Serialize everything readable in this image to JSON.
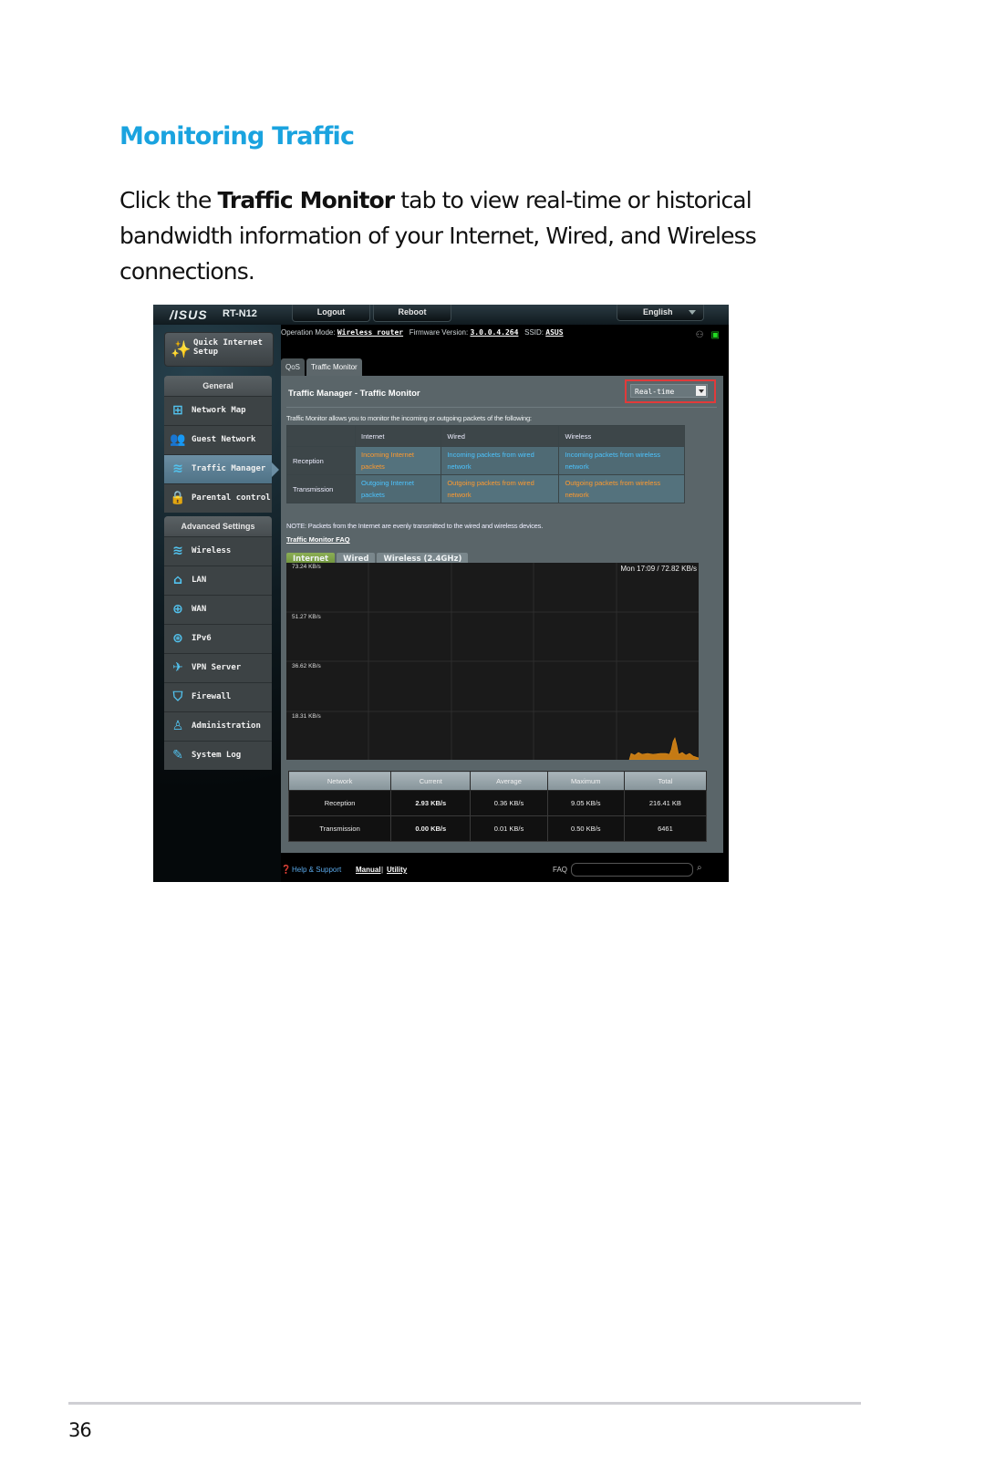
{
  "doc": {
    "title": "Monitoring Traffic",
    "para_prefix": "Click the ",
    "para_bold": "Traffic Monitor",
    "para_suffix": " tab to view real-time or historical bandwidth information of your Internet, Wired, and Wireless connections.",
    "page_number": "36"
  },
  "router": {
    "logo": "/ISUS",
    "model": "RT-N12",
    "logout": "Logout",
    "reboot": "Reboot",
    "language": "English",
    "quick_setup": "Quick Internet Setup",
    "info": {
      "op_mode_label": "Operation Mode:",
      "op_mode": "Wireless router",
      "fw_label": "Firmware Version:",
      "fw": "3.0.0.4.264",
      "ssid_label": "SSID:",
      "ssid": "ASUS"
    },
    "sidebar": {
      "general_header": "General",
      "general_items": [
        {
          "label": "Network Map",
          "icon": "network-map-icon",
          "glyph": "⊞"
        },
        {
          "label": "Guest Network",
          "icon": "guest-network-icon",
          "glyph": "👥"
        },
        {
          "label": "Traffic Manager",
          "icon": "traffic-manager-icon",
          "glyph": "≋",
          "active": true
        },
        {
          "label": "Parental control",
          "icon": "lock-icon",
          "glyph": "🔒"
        }
      ],
      "advanced_header": "Advanced Settings",
      "advanced_items": [
        {
          "label": "Wireless",
          "icon": "wifi-icon",
          "glyph": "≋"
        },
        {
          "label": "LAN",
          "icon": "home-icon",
          "glyph": "⌂"
        },
        {
          "label": "WAN",
          "icon": "globe-icon",
          "glyph": "⊕"
        },
        {
          "label": "IPv6",
          "icon": "ipv6-globe-icon",
          "glyph": "⊛"
        },
        {
          "label": "VPN Server",
          "icon": "vpn-icon",
          "glyph": "✈"
        },
        {
          "label": "Firewall",
          "icon": "shield-icon",
          "glyph": "⛉"
        },
        {
          "label": "Administration",
          "icon": "admin-user-icon",
          "glyph": "♙"
        },
        {
          "label": "System Log",
          "icon": "system-log-icon",
          "glyph": "✎"
        }
      ]
    },
    "subtabs": [
      "QoS",
      "Traffic Monitor"
    ],
    "panel": {
      "title": "Traffic Manager - Traffic Monitor",
      "mode_select": "Real-time",
      "description": "Traffic Monitor allows you to monitor the incoming or outgoing packets of the following:",
      "table": {
        "headers": [
          "",
          "Internet",
          "Wired",
          "Wireless"
        ],
        "rows": [
          {
            "label": "Reception",
            "cells": [
              "Incoming Internet packets",
              "Incoming packets from wired network",
              "Incoming packets from wireless network"
            ]
          },
          {
            "label": "Transmission",
            "cells": [
              "Outgoing Internet packets",
              "Outgoing packets from wired network",
              "Outgoing packets from wireless network"
            ]
          }
        ]
      },
      "note": "NOTE: Packets from the Internet are evenly transmitted to the wired and wireless devices.",
      "faq_link": "Traffic Monitor FAQ",
      "graph_tabs": [
        "Internet",
        "Wired",
        "Wireless (2.4GHz)"
      ],
      "graph": {
        "y_labels": [
          "73.24 KB/s",
          "51.27 KB/s",
          "36.62 KB/s",
          "18.31 KB/s"
        ],
        "time_label": "Mon 17:09 / 72.82 KB/s"
      },
      "stats": {
        "headers": [
          "Network",
          "Current",
          "Average",
          "Maximum",
          "Total"
        ],
        "rows": [
          {
            "network": "Reception",
            "current": "2.93 KB/s",
            "average": "0.36 KB/s",
            "maximum": "9.05 KB/s",
            "total": "216.41 KB"
          },
          {
            "network": "Transmission",
            "current": "0.00 KB/s",
            "average": "0.01 KB/s",
            "maximum": "0.50 KB/s",
            "total": "6461"
          }
        ]
      }
    },
    "footer": {
      "help": "Help & Support",
      "manual": "Manual",
      "separator": "|",
      "utility": "Utility",
      "faq": "FAQ"
    },
    "colors": {
      "accent_title": "#1aa3df",
      "highlight_box": "#e23a3a",
      "reception": "#ff9a2e",
      "transmission": "#4cc4ff"
    }
  }
}
